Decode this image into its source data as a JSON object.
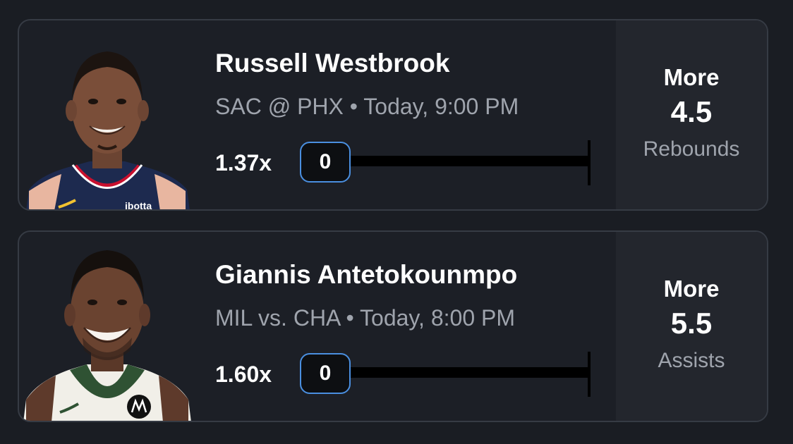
{
  "picks": [
    {
      "player": "Russell Westbrook",
      "matchup": "SAC @ PHX • Today, 9:00 PM",
      "multiplier": "1.37x",
      "current_value": "0",
      "progress": 0,
      "direction": "More",
      "line": "4.5",
      "stat": "Rebounds",
      "jersey_color": "#1d2a4f",
      "jersey_logo_text": "ibotta"
    },
    {
      "player": "Giannis Antetokounmpo",
      "matchup": "MIL vs. CHA • Today, 8:00 PM",
      "multiplier": "1.60x",
      "current_value": "0",
      "progress": 0,
      "direction": "More",
      "line": "5.5",
      "stat": "Assists",
      "jersey_color": "#f1efe8",
      "jersey_logo_text": ""
    }
  ],
  "colors": {
    "accent": "#4a8fe0",
    "background": "#1a1d23",
    "card": "#1c1f26",
    "panel": "#23262d",
    "muted_text": "#9fa4ad"
  }
}
